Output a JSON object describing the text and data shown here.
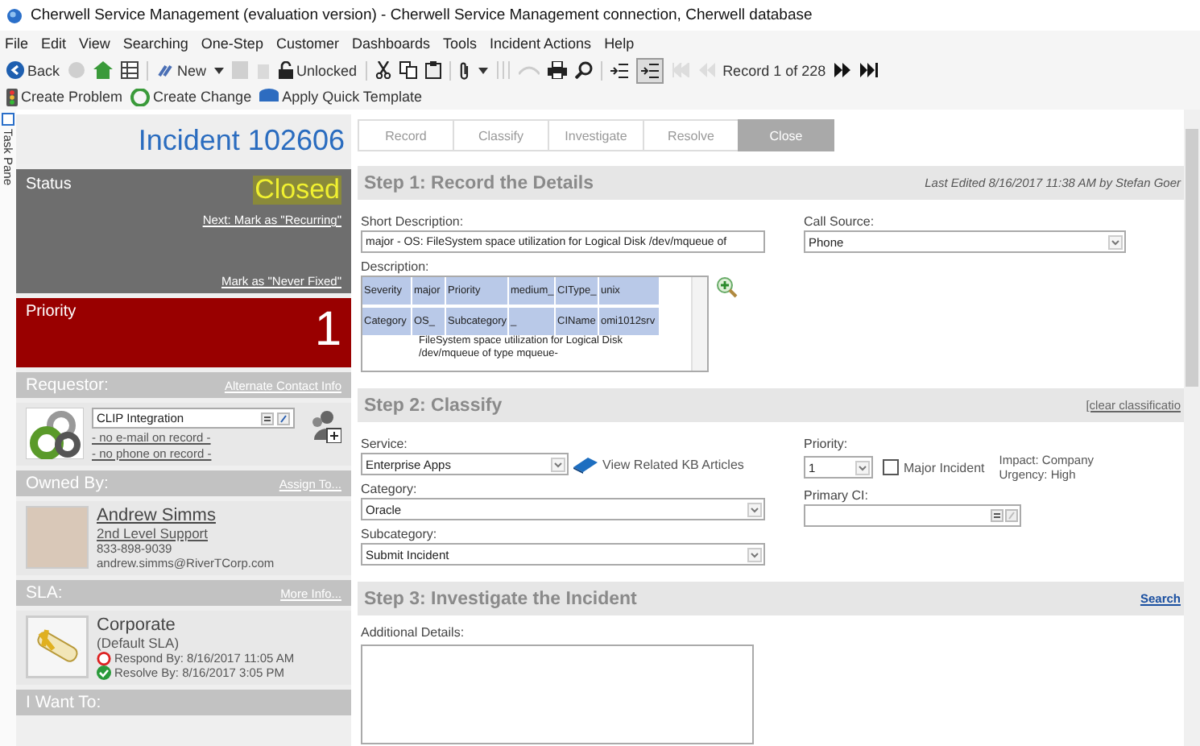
{
  "window": {
    "title": "Cherwell Service Management (evaluation version) - Cherwell Service Management connection, Cherwell database"
  },
  "menu": [
    "File",
    "Edit",
    "View",
    "Searching",
    "One-Step",
    "Customer",
    "Dashboards",
    "Tools",
    "Incident Actions",
    "Help"
  ],
  "toolbar": {
    "back": "Back",
    "new": "New",
    "lock": "Unlocked",
    "record": "Record 1 of 228"
  },
  "quick_actions": [
    "Create Problem",
    "Create Change",
    "Apply Quick Template"
  ],
  "task_pane": "Task Pane",
  "incident": {
    "title": "Incident 102606",
    "status": {
      "label": "Status",
      "value": "Closed",
      "links": [
        "Next: Mark as \"Recurring\"",
        "Mark as \"Never Fixed\""
      ]
    },
    "priority": {
      "label": "Priority",
      "value": "1"
    },
    "requestor": {
      "header": "Requestor:",
      "link": "Alternate Contact Info",
      "name": "CLIP Integration",
      "email": "- no e-mail on record -",
      "phone": "- no phone on record -"
    },
    "owner": {
      "header": "Owned By:",
      "link": "Assign To...",
      "name": "Andrew Simms",
      "team": "2nd Level Support",
      "phone": "833-898-9039",
      "email": "andrew.simms@RiverTCorp.com"
    },
    "sla": {
      "header": "SLA:",
      "link": "More Info...",
      "name": "Corporate",
      "note": "(Default SLA)",
      "respond": "Respond By: 8/16/2017 11:05 AM",
      "resolve": "Resolve By: 8/16/2017 3:05 PM"
    },
    "i_want_to": "I Want To:"
  },
  "tabs": [
    {
      "label": "Record",
      "selected": false
    },
    {
      "label": "Classify",
      "selected": false
    },
    {
      "label": "Investigate",
      "selected": false
    },
    {
      "label": "Resolve",
      "selected": false
    },
    {
      "label": "Close",
      "selected": true
    }
  ],
  "step1": {
    "title": "Step 1:  Record the Details",
    "last_edited": "Last Edited 8/16/2017 11:38 AM by Stefan Goer",
    "short_description": {
      "label": "Short Description:",
      "value": "major - OS: FileSystem space utilization for Logical Disk /dev/mqueue of"
    },
    "call_source": {
      "label": "Call Source:",
      "value": "Phone"
    },
    "description": {
      "label": "Description:",
      "rows": [
        [
          "Severity",
          "major",
          "Priority",
          "medium_",
          "CIType_",
          "unix"
        ],
        [
          "Category",
          "OS_",
          "Subcategory",
          "_",
          "CIName",
          "omi1012srv"
        ]
      ],
      "text": "FileSystem space utilization for Logical Disk /dev/mqueue of type mqueue-"
    }
  },
  "step2": {
    "title": "Step 2:  Classify",
    "link": "[clear classificatio",
    "service": {
      "label": "Service:",
      "value": "Enterprise Apps"
    },
    "kb_link": "View Related KB Articles",
    "category": {
      "label": "Category:",
      "value": "Oracle"
    },
    "subcategory": {
      "label": "Subcategory:",
      "value": "Submit Incident"
    },
    "priority": {
      "label": "Priority:",
      "value": "1"
    },
    "major_incident": {
      "label": "Major Incident",
      "checked": false
    },
    "impact": "Impact: Company",
    "urgency": "Urgency: High",
    "primary_ci": {
      "label": "Primary CI:"
    }
  },
  "step3": {
    "title": "Step 3:  Investigate the Incident",
    "link": "Search",
    "additional_details": {
      "label": "Additional Details:"
    }
  }
}
